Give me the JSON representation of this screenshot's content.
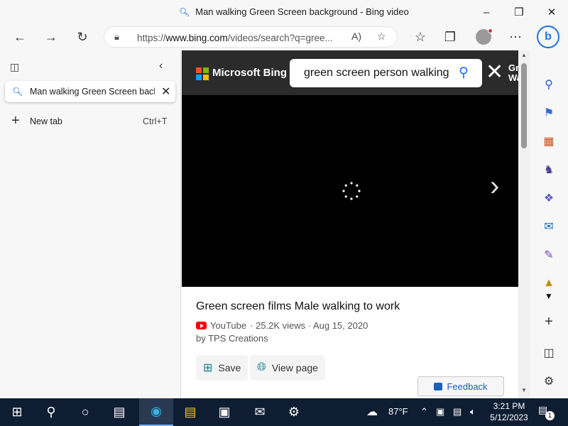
{
  "window": {
    "title": "Man walking Green Screen background - Bing video"
  },
  "address_bar": {
    "url_prefix": "https://",
    "url_host": "www.bing.com",
    "url_path": "/videos/search?q=gree..."
  },
  "tab_pane": {
    "tabs": [
      {
        "title": "Man walking Green Screen background - Bing video"
      }
    ],
    "new_tab_label": "New tab",
    "new_tab_shortcut": "Ctrl+T"
  },
  "bing": {
    "brand": "Microsoft Bing",
    "query": "green screen person walking",
    "cut_label": "Gr\nWa"
  },
  "video": {
    "title": "Green screen films Male walking to work",
    "source": "YouTube",
    "meta": "· 25.2K views · Aug 15, 2020",
    "author": "by TPS Creations",
    "save_label": "Save",
    "view_page_label": "View page",
    "feedback_label": "Feedback"
  },
  "taskbar": {
    "weather": "87°F",
    "time": "3:21 PM",
    "date": "5/12/2023",
    "notification_count": "1"
  },
  "colors": {
    "accent": "#1b72e8",
    "bing_header": "#2b2b2b",
    "taskbar": "#0f1d33",
    "youtube_red": "#ff0000"
  }
}
